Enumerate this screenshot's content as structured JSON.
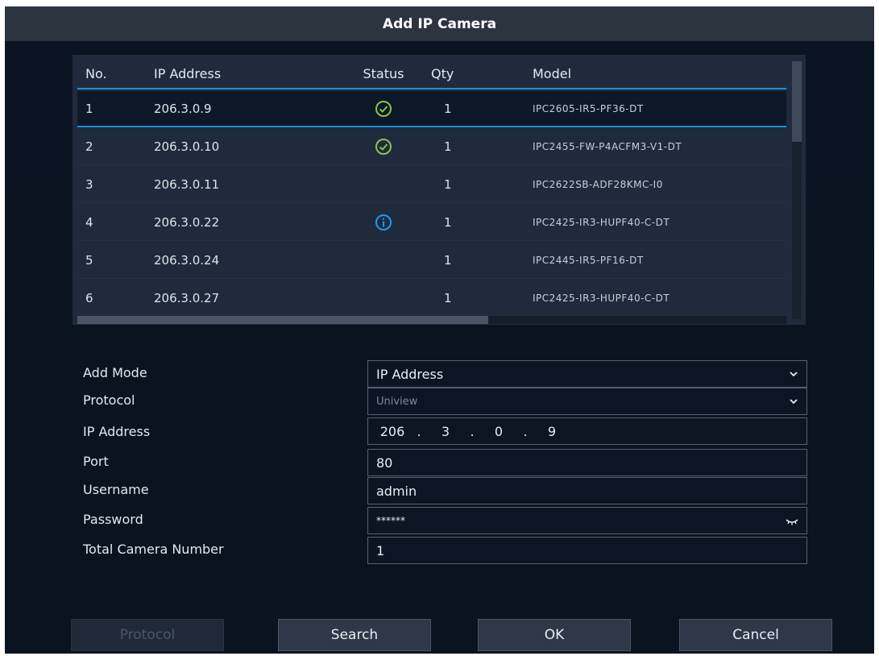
{
  "window": {
    "title": "Add IP Camera"
  },
  "table": {
    "headers": {
      "no": "No.",
      "ip": "IP Address",
      "status": "Status",
      "qty": "Qty",
      "model": "Model"
    },
    "rows": [
      {
        "no": "1",
        "ip": "206.3.0.9",
        "status": "check-circle-icon",
        "qty": "1",
        "model": "IPC2605-IR5-PF36-DT"
      },
      {
        "no": "2",
        "ip": "206.3.0.10",
        "status": "check-circle-icon",
        "qty": "1",
        "model": "IPC2455-FW-P4ACFM3-V1-DT"
      },
      {
        "no": "3",
        "ip": "206.3.0.11",
        "status": "",
        "qty": "1",
        "model": "IPC2622SB-ADF28KMC-I0"
      },
      {
        "no": "4",
        "ip": "206.3.0.22",
        "status": "info-circle-icon",
        "qty": "1",
        "model": "IPC2425-IR3-HUPF40-C-DT"
      },
      {
        "no": "5",
        "ip": "206.3.0.24",
        "status": "",
        "qty": "1",
        "model": "IPC2445-IR5-PF16-DT"
      },
      {
        "no": "6",
        "ip": "206.3.0.27",
        "status": "",
        "qty": "1",
        "model": "IPC2425-IR3-HUPF40-C-DT"
      }
    ]
  },
  "form": {
    "add_mode": {
      "label": "Add Mode",
      "value": "IP Address"
    },
    "protocol": {
      "label": "Protocol",
      "value": "Uniview"
    },
    "ip_address": {
      "label": "IP Address",
      "octets": [
        "206",
        "3",
        "0",
        "9"
      ],
      "sep": "."
    },
    "port": {
      "label": "Port",
      "value": "80"
    },
    "username": {
      "label": "Username",
      "value": "admin"
    },
    "password": {
      "label": "Password",
      "value": "******"
    },
    "total_camera_number": {
      "label": "Total Camera Number",
      "value": "1"
    }
  },
  "buttons": {
    "protocol": "Protocol",
    "search": "Search",
    "ok": "OK",
    "cancel": "Cancel"
  },
  "colors": {
    "accent": "#1d8fdc",
    "online": "#8bc34a",
    "info": "#2196f3"
  }
}
